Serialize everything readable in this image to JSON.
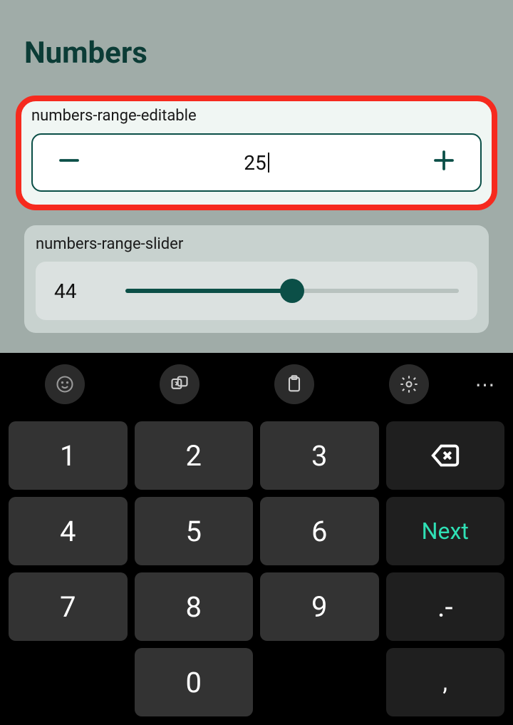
{
  "page": {
    "title": "Numbers"
  },
  "fields": {
    "editable": {
      "label": "numbers-range-editable",
      "value": "25",
      "minus": "−",
      "plus": "+"
    },
    "slider": {
      "label": "numbers-range-slider",
      "value": "44",
      "percent": 50
    }
  },
  "keyboard": {
    "toolbar": {
      "emoji": "emoji-icon",
      "translate": "translate-icon",
      "clipboard": "clipboard-icon",
      "settings": "settings-icon",
      "more": "⋯"
    },
    "keys": {
      "k1": "1",
      "k2": "2",
      "k3": "3",
      "k4": "4",
      "k5": "5",
      "k6": "6",
      "k7": "7",
      "k8": "8",
      "k9": "9",
      "k0": "0",
      "next": "Next",
      "dotdash": ".-",
      "comma": ","
    }
  }
}
